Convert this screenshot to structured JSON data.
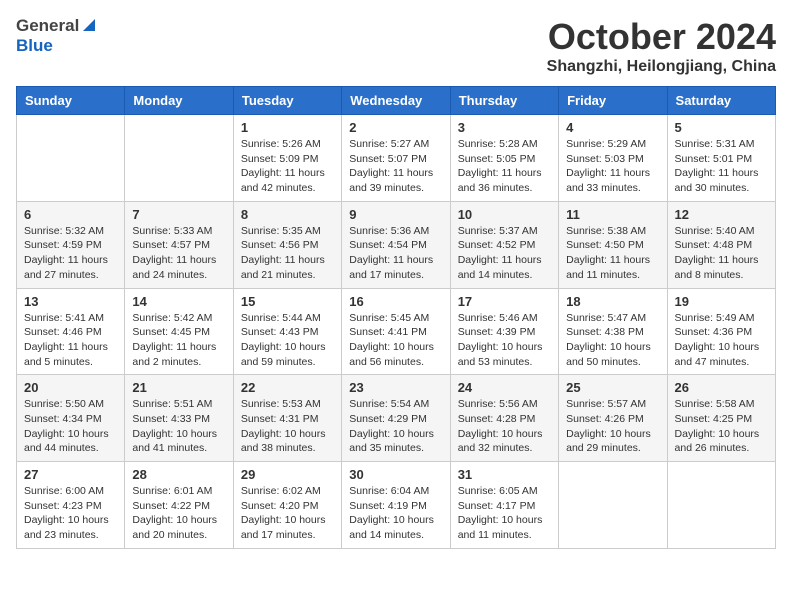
{
  "header": {
    "logo_general": "General",
    "logo_blue": "Blue",
    "month_title": "October 2024",
    "location": "Shangzhi, Heilongjiang, China"
  },
  "days_of_week": [
    "Sunday",
    "Monday",
    "Tuesday",
    "Wednesday",
    "Thursday",
    "Friday",
    "Saturday"
  ],
  "weeks": [
    [
      {
        "day": "",
        "sunrise": "",
        "sunset": "",
        "daylight": ""
      },
      {
        "day": "",
        "sunrise": "",
        "sunset": "",
        "daylight": ""
      },
      {
        "day": "1",
        "sunrise": "Sunrise: 5:26 AM",
        "sunset": "Sunset: 5:09 PM",
        "daylight": "Daylight: 11 hours and 42 minutes."
      },
      {
        "day": "2",
        "sunrise": "Sunrise: 5:27 AM",
        "sunset": "Sunset: 5:07 PM",
        "daylight": "Daylight: 11 hours and 39 minutes."
      },
      {
        "day": "3",
        "sunrise": "Sunrise: 5:28 AM",
        "sunset": "Sunset: 5:05 PM",
        "daylight": "Daylight: 11 hours and 36 minutes."
      },
      {
        "day": "4",
        "sunrise": "Sunrise: 5:29 AM",
        "sunset": "Sunset: 5:03 PM",
        "daylight": "Daylight: 11 hours and 33 minutes."
      },
      {
        "day": "5",
        "sunrise": "Sunrise: 5:31 AM",
        "sunset": "Sunset: 5:01 PM",
        "daylight": "Daylight: 11 hours and 30 minutes."
      }
    ],
    [
      {
        "day": "6",
        "sunrise": "Sunrise: 5:32 AM",
        "sunset": "Sunset: 4:59 PM",
        "daylight": "Daylight: 11 hours and 27 minutes."
      },
      {
        "day": "7",
        "sunrise": "Sunrise: 5:33 AM",
        "sunset": "Sunset: 4:57 PM",
        "daylight": "Daylight: 11 hours and 24 minutes."
      },
      {
        "day": "8",
        "sunrise": "Sunrise: 5:35 AM",
        "sunset": "Sunset: 4:56 PM",
        "daylight": "Daylight: 11 hours and 21 minutes."
      },
      {
        "day": "9",
        "sunrise": "Sunrise: 5:36 AM",
        "sunset": "Sunset: 4:54 PM",
        "daylight": "Daylight: 11 hours and 17 minutes."
      },
      {
        "day": "10",
        "sunrise": "Sunrise: 5:37 AM",
        "sunset": "Sunset: 4:52 PM",
        "daylight": "Daylight: 11 hours and 14 minutes."
      },
      {
        "day": "11",
        "sunrise": "Sunrise: 5:38 AM",
        "sunset": "Sunset: 4:50 PM",
        "daylight": "Daylight: 11 hours and 11 minutes."
      },
      {
        "day": "12",
        "sunrise": "Sunrise: 5:40 AM",
        "sunset": "Sunset: 4:48 PM",
        "daylight": "Daylight: 11 hours and 8 minutes."
      }
    ],
    [
      {
        "day": "13",
        "sunrise": "Sunrise: 5:41 AM",
        "sunset": "Sunset: 4:46 PM",
        "daylight": "Daylight: 11 hours and 5 minutes."
      },
      {
        "day": "14",
        "sunrise": "Sunrise: 5:42 AM",
        "sunset": "Sunset: 4:45 PM",
        "daylight": "Daylight: 11 hours and 2 minutes."
      },
      {
        "day": "15",
        "sunrise": "Sunrise: 5:44 AM",
        "sunset": "Sunset: 4:43 PM",
        "daylight": "Daylight: 10 hours and 59 minutes."
      },
      {
        "day": "16",
        "sunrise": "Sunrise: 5:45 AM",
        "sunset": "Sunset: 4:41 PM",
        "daylight": "Daylight: 10 hours and 56 minutes."
      },
      {
        "day": "17",
        "sunrise": "Sunrise: 5:46 AM",
        "sunset": "Sunset: 4:39 PM",
        "daylight": "Daylight: 10 hours and 53 minutes."
      },
      {
        "day": "18",
        "sunrise": "Sunrise: 5:47 AM",
        "sunset": "Sunset: 4:38 PM",
        "daylight": "Daylight: 10 hours and 50 minutes."
      },
      {
        "day": "19",
        "sunrise": "Sunrise: 5:49 AM",
        "sunset": "Sunset: 4:36 PM",
        "daylight": "Daylight: 10 hours and 47 minutes."
      }
    ],
    [
      {
        "day": "20",
        "sunrise": "Sunrise: 5:50 AM",
        "sunset": "Sunset: 4:34 PM",
        "daylight": "Daylight: 10 hours and 44 minutes."
      },
      {
        "day": "21",
        "sunrise": "Sunrise: 5:51 AM",
        "sunset": "Sunset: 4:33 PM",
        "daylight": "Daylight: 10 hours and 41 minutes."
      },
      {
        "day": "22",
        "sunrise": "Sunrise: 5:53 AM",
        "sunset": "Sunset: 4:31 PM",
        "daylight": "Daylight: 10 hours and 38 minutes."
      },
      {
        "day": "23",
        "sunrise": "Sunrise: 5:54 AM",
        "sunset": "Sunset: 4:29 PM",
        "daylight": "Daylight: 10 hours and 35 minutes."
      },
      {
        "day": "24",
        "sunrise": "Sunrise: 5:56 AM",
        "sunset": "Sunset: 4:28 PM",
        "daylight": "Daylight: 10 hours and 32 minutes."
      },
      {
        "day": "25",
        "sunrise": "Sunrise: 5:57 AM",
        "sunset": "Sunset: 4:26 PM",
        "daylight": "Daylight: 10 hours and 29 minutes."
      },
      {
        "day": "26",
        "sunrise": "Sunrise: 5:58 AM",
        "sunset": "Sunset: 4:25 PM",
        "daylight": "Daylight: 10 hours and 26 minutes."
      }
    ],
    [
      {
        "day": "27",
        "sunrise": "Sunrise: 6:00 AM",
        "sunset": "Sunset: 4:23 PM",
        "daylight": "Daylight: 10 hours and 23 minutes."
      },
      {
        "day": "28",
        "sunrise": "Sunrise: 6:01 AM",
        "sunset": "Sunset: 4:22 PM",
        "daylight": "Daylight: 10 hours and 20 minutes."
      },
      {
        "day": "29",
        "sunrise": "Sunrise: 6:02 AM",
        "sunset": "Sunset: 4:20 PM",
        "daylight": "Daylight: 10 hours and 17 minutes."
      },
      {
        "day": "30",
        "sunrise": "Sunrise: 6:04 AM",
        "sunset": "Sunset: 4:19 PM",
        "daylight": "Daylight: 10 hours and 14 minutes."
      },
      {
        "day": "31",
        "sunrise": "Sunrise: 6:05 AM",
        "sunset": "Sunset: 4:17 PM",
        "daylight": "Daylight: 10 hours and 11 minutes."
      },
      {
        "day": "",
        "sunrise": "",
        "sunset": "",
        "daylight": ""
      },
      {
        "day": "",
        "sunrise": "",
        "sunset": "",
        "daylight": ""
      }
    ]
  ]
}
